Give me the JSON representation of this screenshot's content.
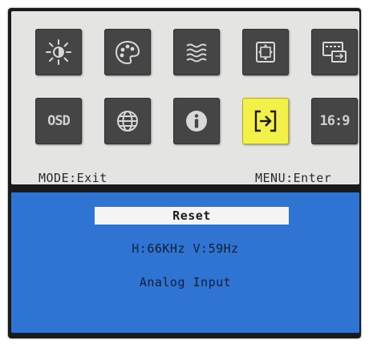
{
  "menu": {
    "icons": [
      {
        "name": "brightness-icon"
      },
      {
        "name": "color-palette-icon"
      },
      {
        "name": "image-adjust-icon"
      },
      {
        "name": "position-icon"
      },
      {
        "name": "language-display-icon"
      },
      {
        "name": "osd-settings-icon",
        "text": "OSD"
      },
      {
        "name": "globe-language-icon"
      },
      {
        "name": "info-icon"
      },
      {
        "name": "reset-input-icon"
      },
      {
        "name": "aspect-ratio-icon",
        "text": "16:9"
      }
    ],
    "selected_index": 8,
    "mode_hint": "MODE:Exit",
    "menu_hint": "MENU:Enter"
  },
  "status": {
    "selected_item": "Reset",
    "frequency": "H:66KHz V:59Hz",
    "input_source": "Analog Input"
  },
  "colors": {
    "panel_top": "#e4e5e3",
    "tile": "#454545",
    "tile_selected": "#f3f04a",
    "panel_bottom": "#2f74d3",
    "highlight_box": "#f4f4f4"
  }
}
